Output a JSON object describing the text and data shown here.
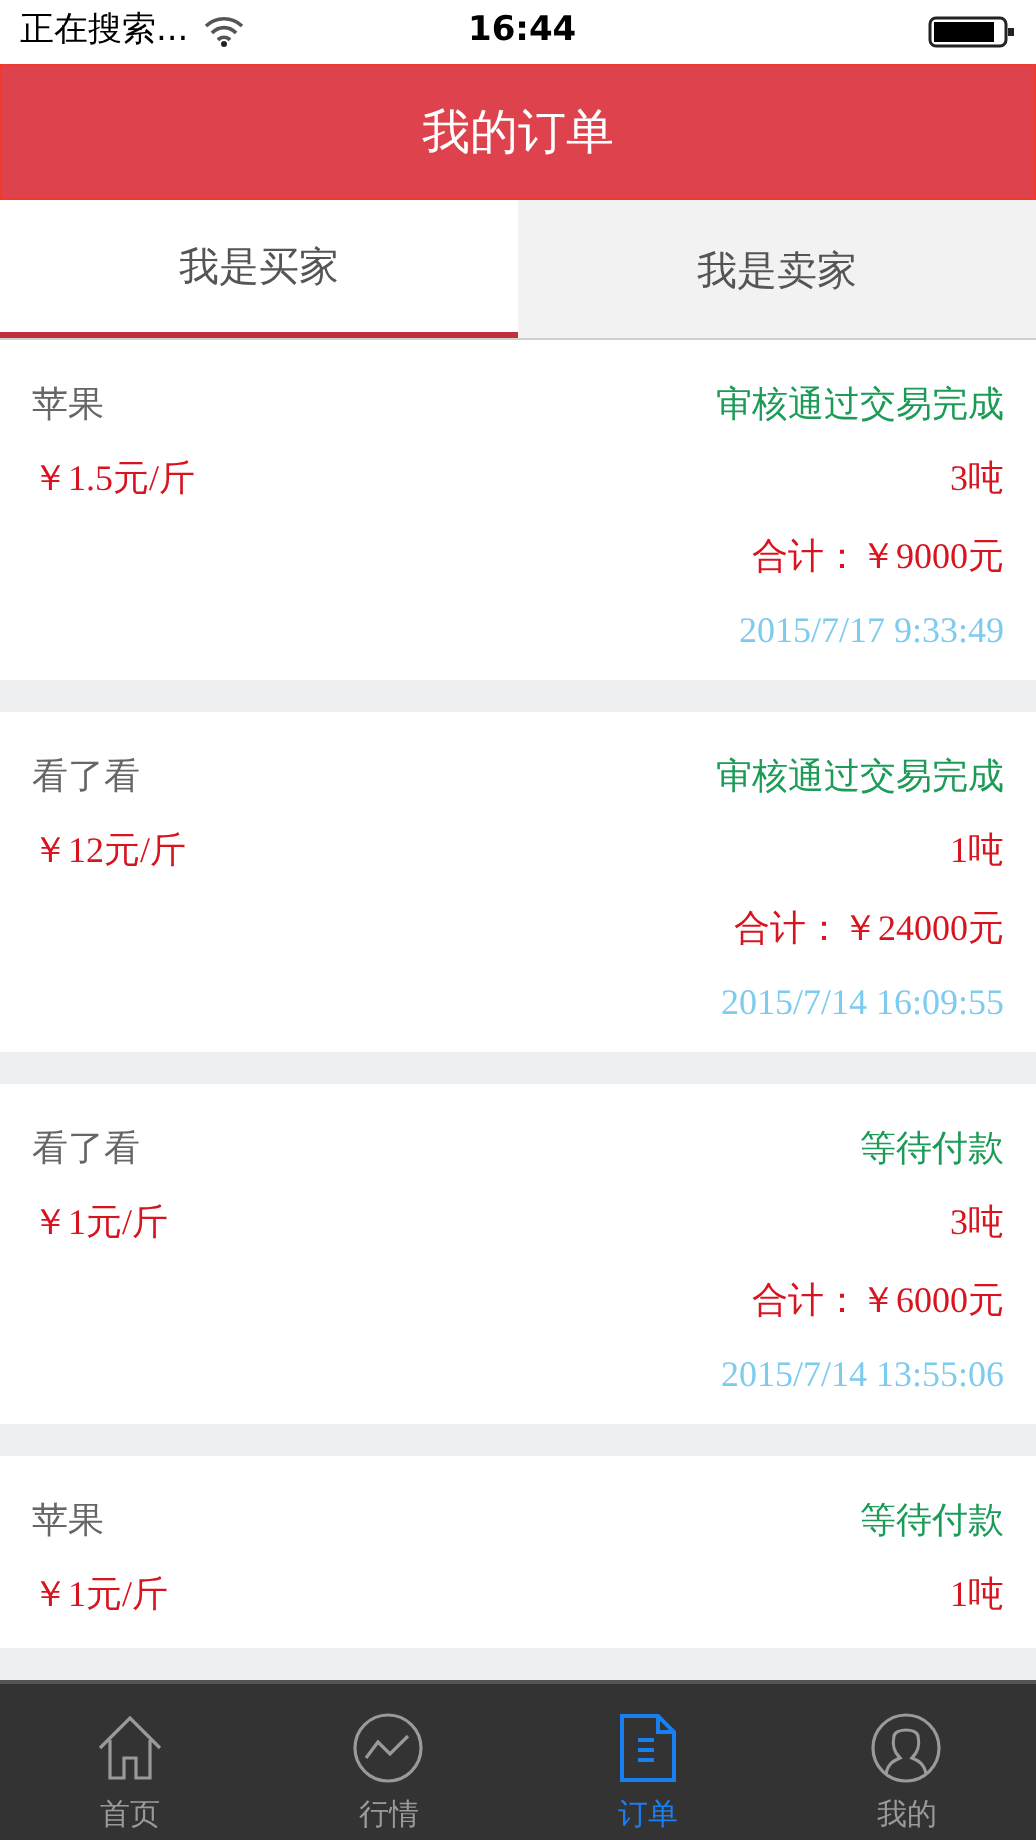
{
  "status_bar": {
    "carrier": "正在搜索...",
    "time": "16:44"
  },
  "header": {
    "title": "我的订单"
  },
  "tabs": [
    {
      "label": "我是买家",
      "selected": true
    },
    {
      "label": "我是卖家",
      "selected": false
    }
  ],
  "orders": [
    {
      "product": "苹果",
      "status": "审核通过交易完成",
      "price": "￥1.5元/斤",
      "quantity": "3吨",
      "total": "合计：￥9000元",
      "time": "2015/7/17 9:33:49"
    },
    {
      "product": "看了看",
      "status": "审核通过交易完成",
      "price": "￥12元/斤",
      "quantity": "1吨",
      "total": "合计：￥24000元",
      "time": "2015/7/14 16:09:55"
    },
    {
      "product": "看了看",
      "status": "等待付款",
      "price": "￥1元/斤",
      "quantity": "3吨",
      "total": "合计：￥6000元",
      "time": "2015/7/14 13:55:06"
    },
    {
      "product": "苹果",
      "status": "等待付款",
      "price": "￥1元/斤",
      "quantity": "1吨"
    }
  ],
  "nav": [
    {
      "kind": "home",
      "label": "首页",
      "selected": false
    },
    {
      "kind": "market",
      "label": "行情",
      "selected": false
    },
    {
      "kind": "orders",
      "label": "订单",
      "selected": true
    },
    {
      "kind": "profile",
      "label": "我的",
      "selected": false
    }
  ]
}
